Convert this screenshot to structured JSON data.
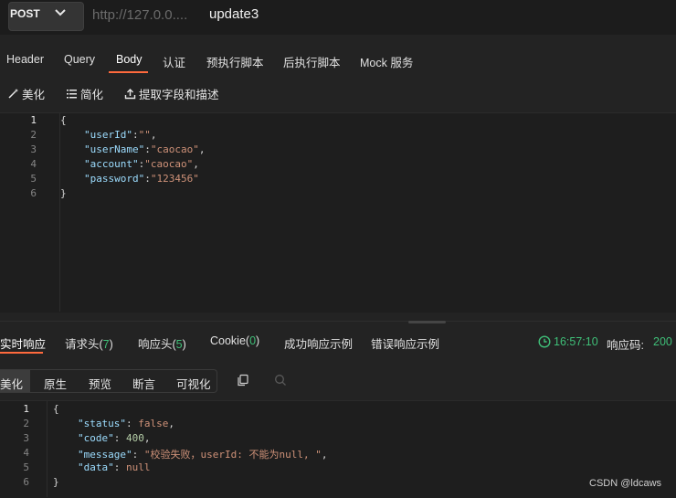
{
  "request": {
    "method": "POST",
    "url": "http://127.0.0....",
    "name": "update3"
  },
  "tabs": [
    "Header",
    "Query",
    "Body",
    "认证",
    "预执行脚本",
    "后执行脚本",
    "Mock 服务"
  ],
  "active_tab": "Body",
  "toolbar": {
    "beautify": "美化",
    "simplify": "简化",
    "extract": "提取字段和描述"
  },
  "body_lines": {
    "n": [
      "1",
      "2",
      "3",
      "4",
      "5",
      "6"
    ],
    "l1": "{",
    "l2_key": "\"userId\"",
    "l2_val": "\"\"",
    "l3_key": "\"userName\"",
    "l3_val": "\"caocao\"",
    "l4_key": "\"account\"",
    "l4_val": "\"caocao\"",
    "l5_key": "\"password\"",
    "l5_val": "\"123456\"",
    "l6": "}"
  },
  "response_tabs": {
    "realtime": "实时响应",
    "req_headers": "请求头(",
    "req_headers_count": "7",
    "resp_headers": "响应头(",
    "resp_headers_count": "5",
    "cookie": "Cookie(",
    "cookie_count": "0",
    "close_paren": ")",
    "success_example": "成功响应示例",
    "error_example": "错误响应示例"
  },
  "response_meta": {
    "time": "16:57:10",
    "status_label": "响应码:",
    "status_code": "200"
  },
  "view_modes": [
    "美化",
    "原生",
    "预览",
    "断言",
    "可视化"
  ],
  "response_lines": {
    "n": [
      "1",
      "2",
      "3",
      "4",
      "5",
      "6"
    ],
    "l1": "{",
    "l2_key": "\"status\"",
    "l2_val": "false",
    "l3_key": "\"code\"",
    "l3_val": "400",
    "l4_key": "\"message\"",
    "l4_val": "\"校验失败，userId: 不能为null, \"",
    "l5_key": "\"data\"",
    "l5_val": "null",
    "l6": "}"
  },
  "colors": {
    "accent": "#ff6a3d",
    "status_green": "#3fbf78",
    "json_key": "#9cdcfe",
    "json_string": "#ce9178"
  },
  "watermark": "CSDN @ldcaws"
}
